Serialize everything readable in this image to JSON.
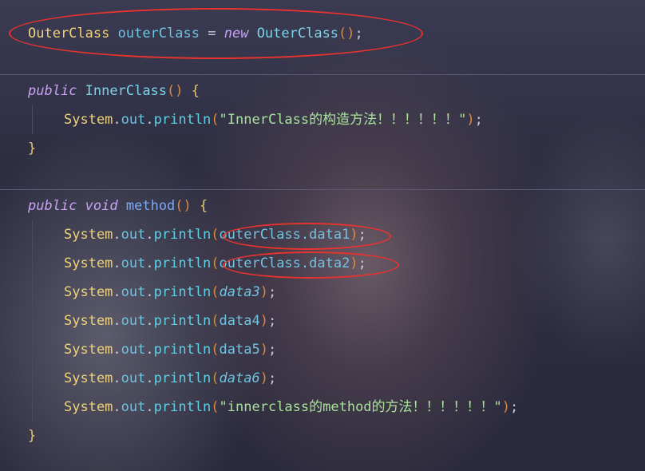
{
  "code": {
    "l1": {
      "t1": "OuterClass",
      "t2": "outerClass",
      "t3": "=",
      "t4": "new",
      "t5": "OuterClass",
      "t6": "()",
      "t7": ";"
    },
    "l2": {
      "kw": "public",
      "name": "InnerClass",
      "parens": "()",
      "brace": "{"
    },
    "l3": {
      "sys": "System",
      "out": "out",
      "println": "println",
      "open": "(",
      "str": "\"InnerClass的构造方法！！！！！！\"",
      "close": ")",
      "semi": ";"
    },
    "l4": {
      "brace": "}"
    },
    "l5": {
      "kw1": "public",
      "kw2": "void",
      "name": "method",
      "parens": "()",
      "brace": "{"
    },
    "l6": {
      "sys": "System",
      "out": "out",
      "println": "println",
      "open": "(",
      "arg": "outerClass.data1",
      "close": ")",
      "semi": ";"
    },
    "l7": {
      "sys": "System",
      "out": "out",
      "println": "println",
      "open": "(",
      "arg": "outerClass.data2",
      "close": ")",
      "semi": ";"
    },
    "l8": {
      "sys": "System",
      "out": "out",
      "println": "println",
      "open": "(",
      "arg": "data3",
      "close": ")",
      "semi": ";"
    },
    "l9": {
      "sys": "System",
      "out": "out",
      "println": "println",
      "open": "(",
      "arg": "data4",
      "close": ")",
      "semi": ";"
    },
    "l10": {
      "sys": "System",
      "out": "out",
      "println": "println",
      "open": "(",
      "arg": "data5",
      "close": ")",
      "semi": ";"
    },
    "l11": {
      "sys": "System",
      "out": "out",
      "println": "println",
      "open": "(",
      "arg": "data6",
      "close": ")",
      "semi": ";"
    },
    "l12": {
      "sys": "System",
      "out": "out",
      "println": "println",
      "open": "(",
      "str": "\"innerclass的method的方法！！！！！！\"",
      "close": ")",
      "semi": ";"
    },
    "l13": {
      "brace": "}"
    }
  },
  "colors": {
    "annotation": "#e8332e",
    "keyword": "#c9a2f5",
    "type": "#f0d27a",
    "string": "#a8e29a",
    "field": "#6fc3e0"
  }
}
